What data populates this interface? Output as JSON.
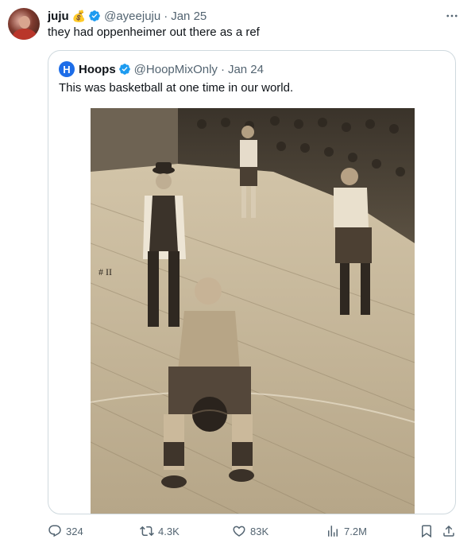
{
  "tweet": {
    "author_name": "juju",
    "author_emoji": "💰",
    "handle": "@ayeejuju",
    "separator": "·",
    "date": "Jan 25",
    "text": "they had oppenheimer out there as a ref",
    "more_icon": "more-horizontal-icon"
  },
  "quoted": {
    "avatar_letter": "H",
    "author_name": "Hoops",
    "handle": "@HoopMixOnly",
    "separator": "·",
    "date": "Jan 24",
    "text": "This was basketball at one time in our world.",
    "image_caption_marking": "# II"
  },
  "actions": {
    "replies": "324",
    "retweets": "4.3K",
    "likes": "83K",
    "views": "7.2M"
  },
  "colors": {
    "verified_badge": "#1d9bf0",
    "secondary_text": "#536471",
    "border": "#cfd9de",
    "quoted_avatar": "#1d6de8"
  }
}
